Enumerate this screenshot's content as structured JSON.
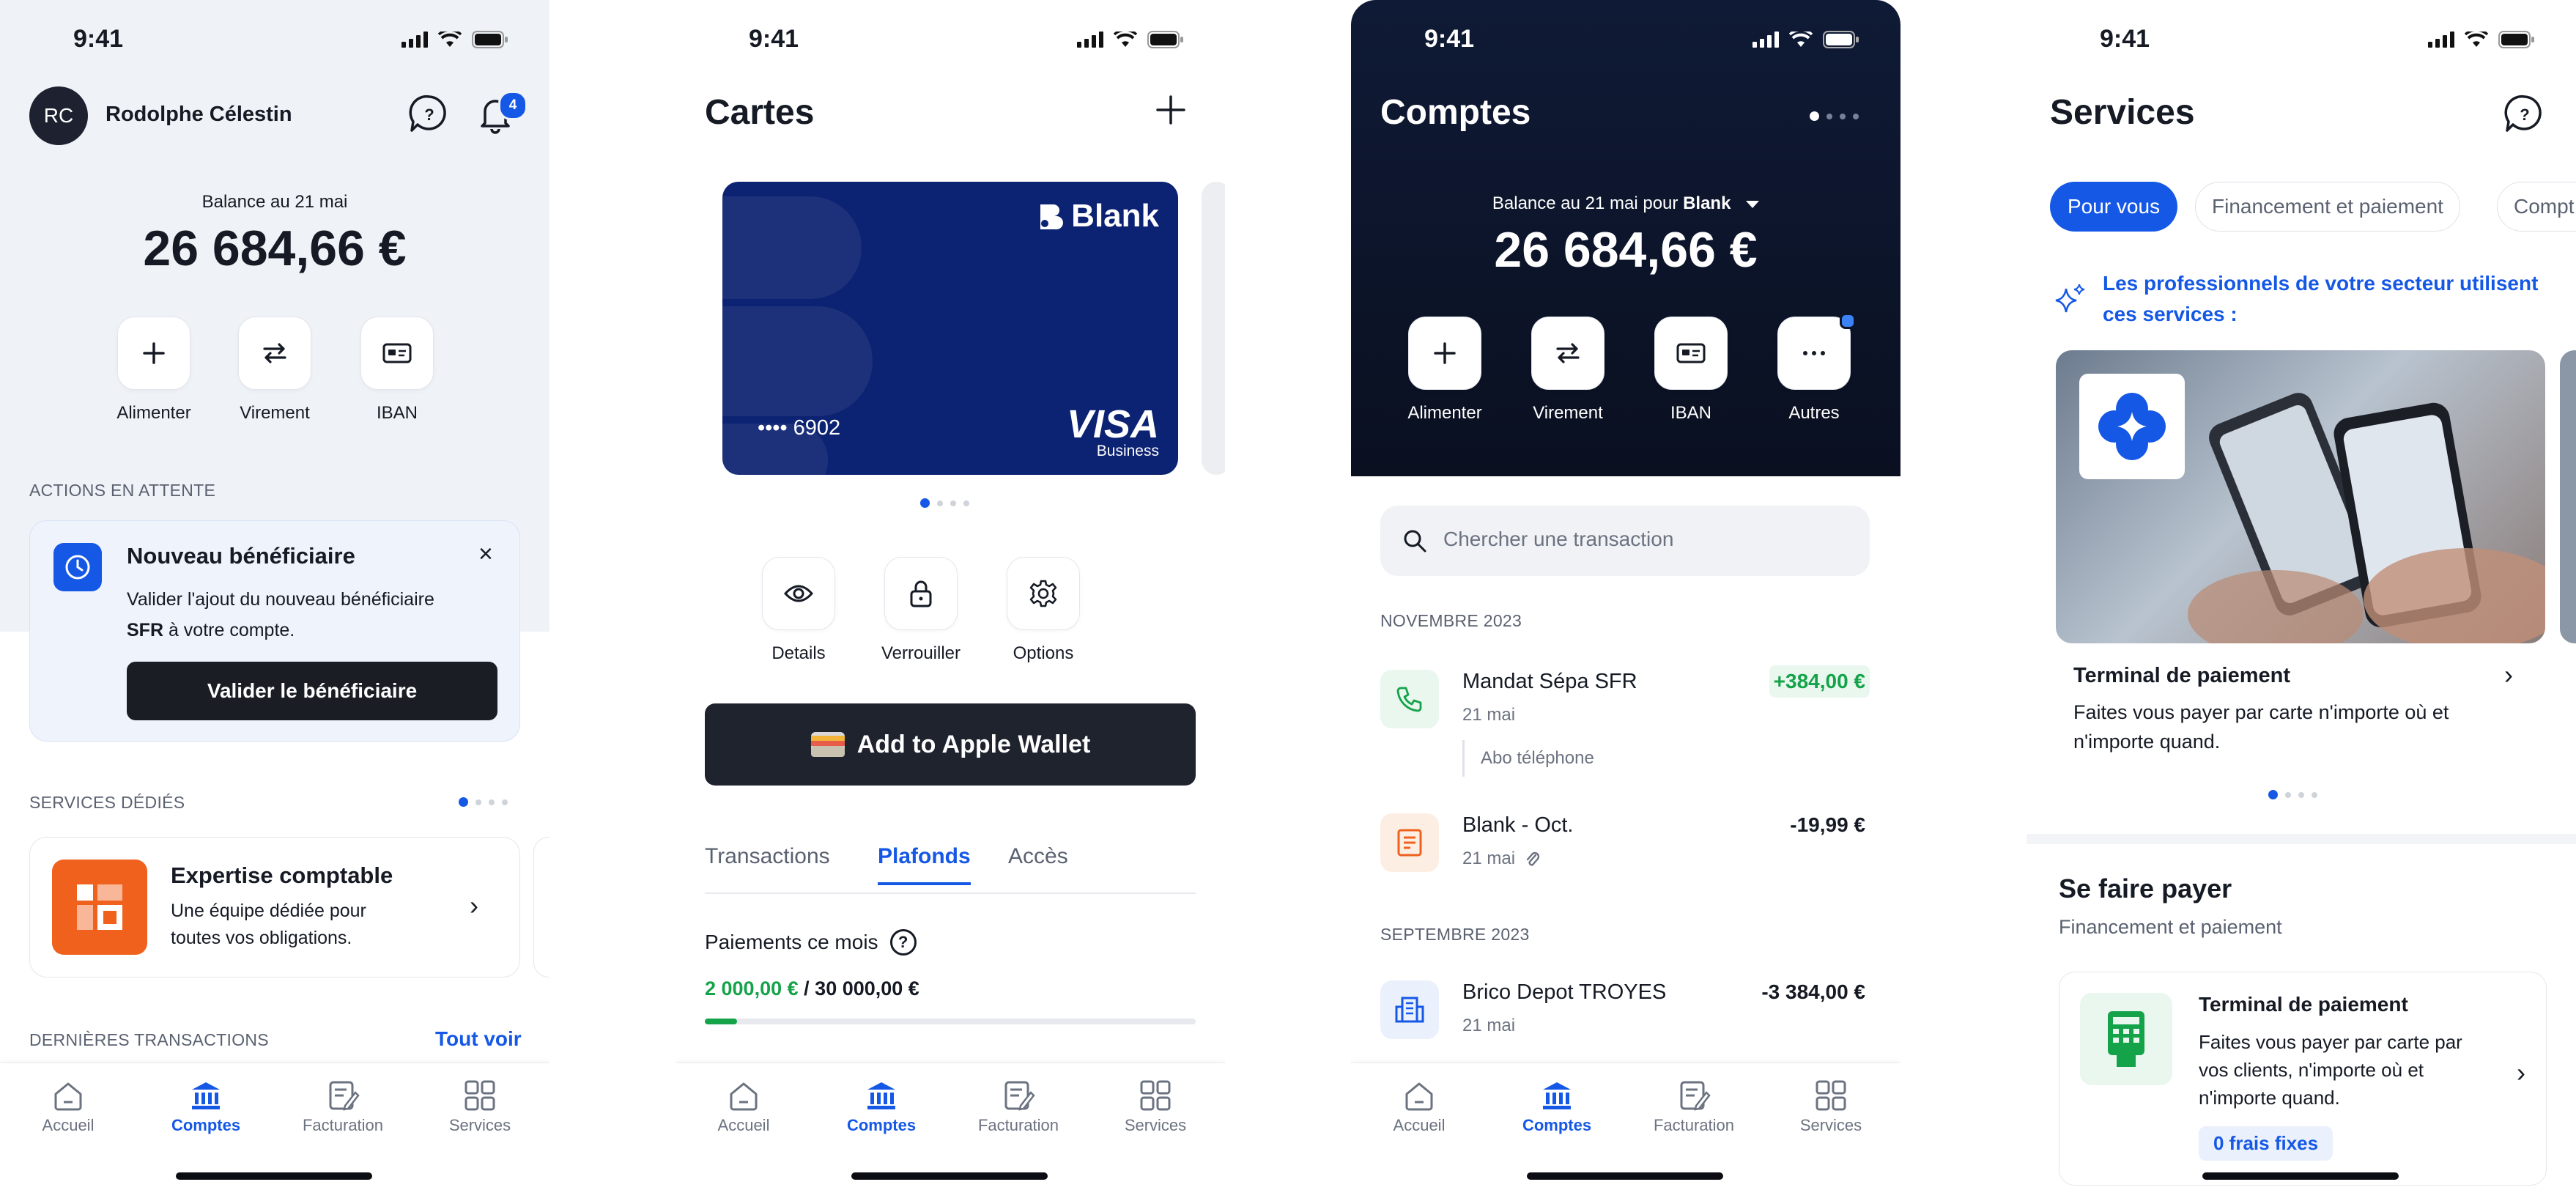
{
  "status_time": "9:41",
  "colors": {
    "accent": "#1558e6",
    "positive": "#15a34a",
    "dark": "#1a1d24",
    "navy": "#0c2272"
  },
  "screen1": {
    "avatar_initials": "RC",
    "user_name": "Rodolphe Célestin",
    "notification_count": "4",
    "balance_label": "Balance au 21 mai",
    "balance": "26 684,66 €",
    "actions": [
      {
        "label": "Alimenter",
        "icon": "plus-icon"
      },
      {
        "label": "Virement",
        "icon": "transfer-icon"
      },
      {
        "label": "IBAN",
        "icon": "iban-card-icon"
      }
    ],
    "pending_title": "ACTIONS EN ATTENTE",
    "pending_card": {
      "title": "Nouveau bénéficiaire",
      "text_before": "Valider l'ajout du nouveau bénéficiaire ",
      "text_bold": "SFR",
      "text_after": " à votre compte.",
      "button": "Valider le bénéficiaire"
    },
    "services_title": "SERVICES DÉDIÉS",
    "service_card": {
      "title": "Expertise comptable",
      "text": "Une équipe dédiée pour toutes vos obligations."
    },
    "last_tx_title": "DERNIÈRES TRANSACTIONS",
    "see_all": "Tout voir"
  },
  "screen2": {
    "title": "Cartes",
    "card": {
      "brand": "Blank",
      "masked": "•••• 6902",
      "network": "VISA",
      "network_sub": "Business"
    },
    "actions": [
      {
        "label": "Details",
        "icon": "eye-icon"
      },
      {
        "label": "Verrouiller",
        "icon": "lock-icon"
      },
      {
        "label": "Options",
        "icon": "gear-icon"
      }
    ],
    "wallet_button": "Add to Apple Wallet",
    "tabs": [
      "Transactions",
      "Plafonds",
      "Accès"
    ],
    "active_tab": 1,
    "limit_label": "Paiements ce mois",
    "limit_used": "2 000,00 €",
    "limit_separator": "/",
    "limit_total": "30 000,00 €",
    "limit_progress": 0.066
  },
  "screen3": {
    "title": "Comptes",
    "balance_label": "Balance au 21 mai pour ",
    "balance_account": "Blank",
    "balance": "26 684,66 €",
    "actions": [
      {
        "label": "Alimenter",
        "icon": "plus-icon"
      },
      {
        "label": "Virement",
        "icon": "transfer-icon"
      },
      {
        "label": "IBAN",
        "icon": "iban-card-icon"
      },
      {
        "label": "Autres",
        "icon": "more-dots-icon"
      }
    ],
    "search_placeholder": "Chercher une transaction",
    "groups": [
      {
        "month": "NOVEMBRE 2023",
        "items": [
          {
            "name": "Mandat Sépa SFR",
            "date": "21 mai",
            "amount": "+384,00 €",
            "note": "Abo téléphone",
            "icon": "phone-icon"
          },
          {
            "name": "Blank - Oct.",
            "date": "21 mai",
            "amount": "-19,99 €",
            "icon": "receipt-icon"
          }
        ]
      },
      {
        "month": "SEPTEMBRE 2023",
        "items": [
          {
            "name": "Brico Depot TROYES",
            "date": "21 mai",
            "amount": "-3 384,00 €",
            "icon": "building-icon"
          }
        ]
      }
    ]
  },
  "screen4": {
    "title": "Services",
    "chips": [
      "Pour vous",
      "Financement et paiement",
      "Compt"
    ],
    "promo": "Les professionnels de votre secteur utilisent ces services :",
    "feature": {
      "title": "Terminal de paiement",
      "text": "Faites vous payer par carte n'importe où et n'importe quand."
    },
    "section_title": "Se faire payer",
    "section_sub": "Financement et paiement",
    "service": {
      "title": "Terminal de paiement",
      "text": "Faites vous payer par carte par vos clients, n'importe où et n'importe quand.",
      "badge": "0 frais fixes"
    }
  },
  "tabbar": [
    {
      "label": "Accueil",
      "icon": "home-icon"
    },
    {
      "label": "Comptes",
      "icon": "bank-icon"
    },
    {
      "label": "Facturation",
      "icon": "invoice-icon"
    },
    {
      "label": "Services",
      "icon": "grid-icon"
    }
  ]
}
